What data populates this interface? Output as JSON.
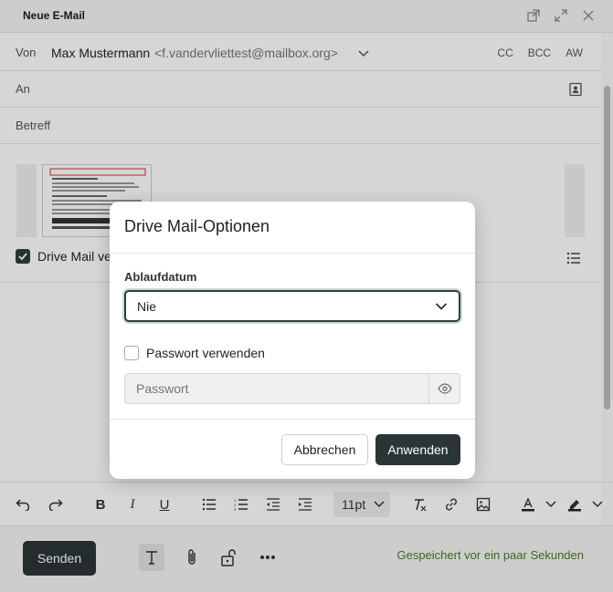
{
  "window": {
    "title": "Neue E-Mail",
    "icons": [
      "popout-icon",
      "expand-icon",
      "close-icon"
    ]
  },
  "header": {
    "from_label": "Von",
    "from_name": "Max Mustermann",
    "from_email": "<f.vandervliettest@mailbox.org>",
    "cc": "CC",
    "bcc": "BCC",
    "reply_to": "AW",
    "to_label": "An",
    "subject_label": "Betreff"
  },
  "attachment": {
    "drive_mail_label": "Drive Mail ve",
    "drive_mail_checked": true
  },
  "toolbar": {
    "font_size": "11pt",
    "icons": [
      "undo-icon",
      "redo-icon",
      "bold-icon",
      "italic-icon",
      "underline-icon",
      "bullet-list-icon",
      "numbered-list-icon",
      "outdent-icon",
      "indent-icon",
      "clear-format-icon",
      "link-icon",
      "image-icon",
      "text-color-icon",
      "highlight-icon"
    ]
  },
  "footer": {
    "send_label": "Senden",
    "saved_status": "Gespeichert vor ein paar Sekunden",
    "icons": [
      "text-format-icon",
      "attach-icon",
      "lock-icon",
      "more-icon"
    ]
  },
  "modal": {
    "title": "Drive Mail-Optionen",
    "expiry_label": "Ablaufdatum",
    "expiry_value": "Nie",
    "use_password_label": "Passwort verwenden",
    "use_password_checked": false,
    "password_placeholder": "Passwort",
    "cancel_label": "Abbrechen",
    "apply_label": "Anwenden"
  },
  "colors": {
    "primary_dark": "#2c3536",
    "saved_green": "#4a7a23"
  }
}
